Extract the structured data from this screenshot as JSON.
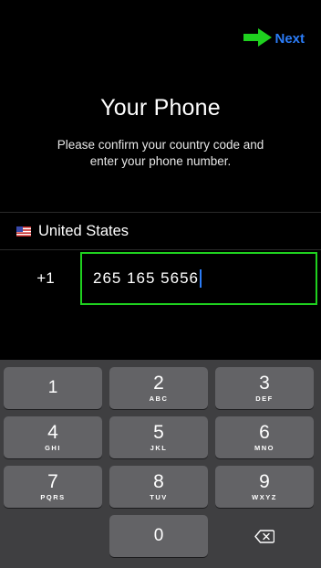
{
  "header": {
    "next_label": "Next"
  },
  "title": "Your Phone",
  "subtitle": "Please confirm your country code and enter your phone number.",
  "country": {
    "name": "United States"
  },
  "phone": {
    "code": "+1",
    "number": "265 165 5656"
  },
  "colors": {
    "accent": "#2b7cf7",
    "highlight": "#1fd11f"
  },
  "keypad": {
    "keys": [
      {
        "num": "1",
        "letters": ""
      },
      {
        "num": "2",
        "letters": "ABC"
      },
      {
        "num": "3",
        "letters": "DEF"
      },
      {
        "num": "4",
        "letters": "GHI"
      },
      {
        "num": "5",
        "letters": "JKL"
      },
      {
        "num": "6",
        "letters": "MNO"
      },
      {
        "num": "7",
        "letters": "PQRS"
      },
      {
        "num": "8",
        "letters": "TUV"
      },
      {
        "num": "9",
        "letters": "WXYZ"
      },
      {
        "num": "0",
        "letters": ""
      }
    ],
    "delete_icon": "backspace-icon"
  }
}
